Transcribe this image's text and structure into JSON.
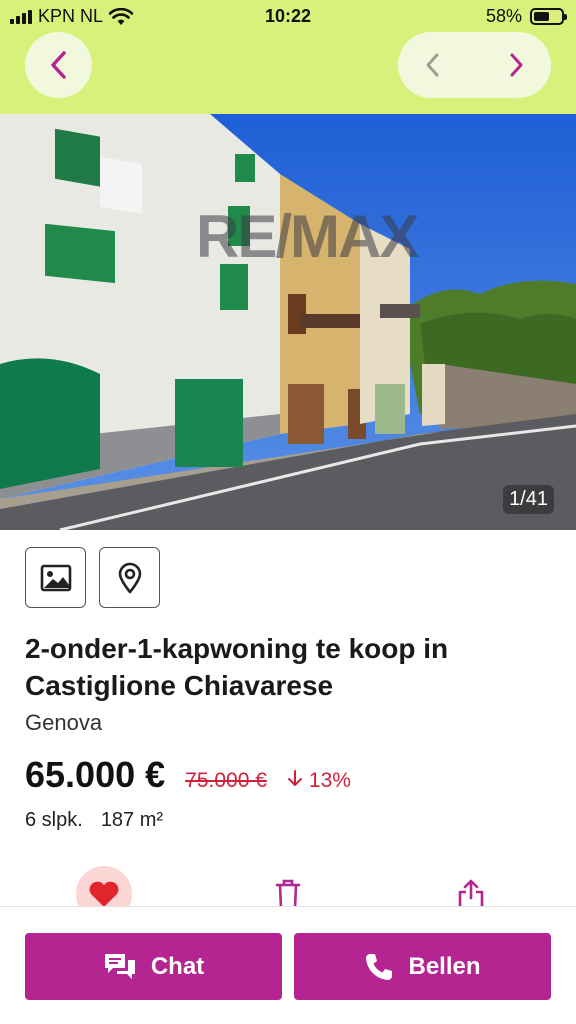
{
  "status_bar": {
    "carrier": "KPN NL",
    "time": "10:22",
    "battery": "58%",
    "battery_level": 0.58
  },
  "nav": {
    "back_icon": "chevron-left-icon",
    "prev_icon": "chevron-left-icon",
    "next_icon": "chevron-right-icon"
  },
  "gallery": {
    "counter": "1/41",
    "watermark": "RE/MAX"
  },
  "media_tabs": [
    {
      "icon": "image-icon"
    },
    {
      "icon": "map-pin-icon"
    }
  ],
  "listing": {
    "title": "2-onder-1-kapwoning te koop in Castiglione Chiavarese",
    "city": "Genova",
    "price": "65.000 €",
    "old_price": "75.000 €",
    "drop_percent": "13%",
    "bedrooms": "6 slpk.",
    "area": "187 m²"
  },
  "actions": {
    "favorite_icon": "heart-icon",
    "delete_icon": "trash-icon",
    "share_icon": "share-icon"
  },
  "cta": {
    "chat_label": "Chat",
    "call_label": "Bellen"
  },
  "colors": {
    "header_bg": "#d9f07a",
    "accent": "#b42592",
    "price_drop": "#d0203b",
    "favorite": "#e0252d"
  }
}
